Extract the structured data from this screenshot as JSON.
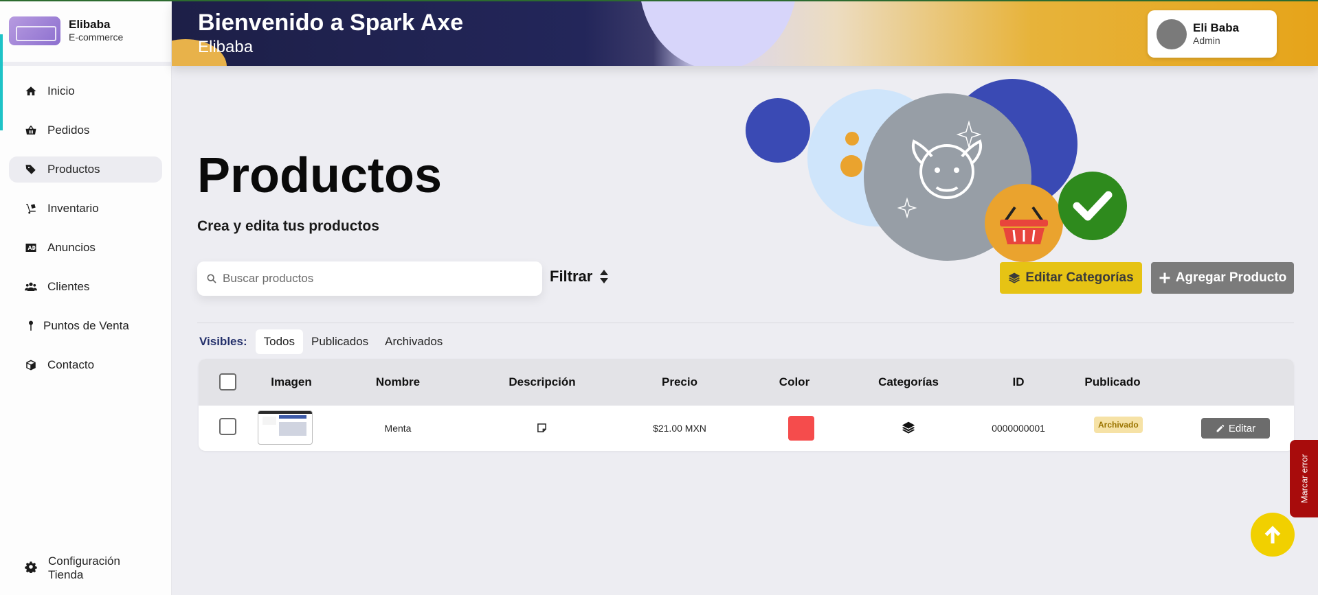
{
  "brand": {
    "name": "Elibaba",
    "subtitle": "E-commerce"
  },
  "sidebar": {
    "items": [
      {
        "label": "Inicio",
        "icon": "home-icon"
      },
      {
        "label": "Pedidos",
        "icon": "basket-icon"
      },
      {
        "label": "Productos",
        "icon": "tags-icon",
        "active": true
      },
      {
        "label": "Inventario",
        "icon": "dolly-icon"
      },
      {
        "label": "Anuncios",
        "icon": "ad-icon"
      },
      {
        "label": "Clientes",
        "icon": "users-icon"
      },
      {
        "label": "Puntos de Venta",
        "icon": "map-pin-icon"
      },
      {
        "label": "Contacto",
        "icon": "box-icon"
      }
    ],
    "settings": {
      "line1": "Configuración",
      "line2": "Tienda",
      "icon": "gear-icon"
    }
  },
  "header": {
    "title": "Bienvenido a Spark Axe",
    "subtitle": "Elibaba"
  },
  "user": {
    "name": "Eli Baba",
    "role": "Admin"
  },
  "main": {
    "title": "Productos",
    "subtitle": "Crea y edita tus productos",
    "search": {
      "placeholder": "Buscar productos",
      "value": ""
    },
    "filter_label": "Filtrar",
    "edit_categories_label": "Editar Categorías",
    "add_product_label": "Agregar Producto",
    "tabs": {
      "label": "Visibles:",
      "items": [
        "Todos",
        "Publicados",
        "Archivados"
      ],
      "active": "Todos"
    }
  },
  "table": {
    "headers": [
      "Imagen",
      "Nombre",
      "Descripción",
      "Precio",
      "Color",
      "Categorías",
      "ID",
      "Publicado"
    ],
    "rows": [
      {
        "name": "Menta",
        "price": "$21.00 MXN",
        "color": "#f54c4c",
        "id": "0000000001",
        "status": "Archivado",
        "action": "Editar"
      }
    ]
  },
  "report_label": "Marcar error",
  "colors": {
    "accent": "#e6c314",
    "header_dark": "#1d1f47",
    "report": "#a80c0c",
    "scroll_top": "#f1d000"
  }
}
